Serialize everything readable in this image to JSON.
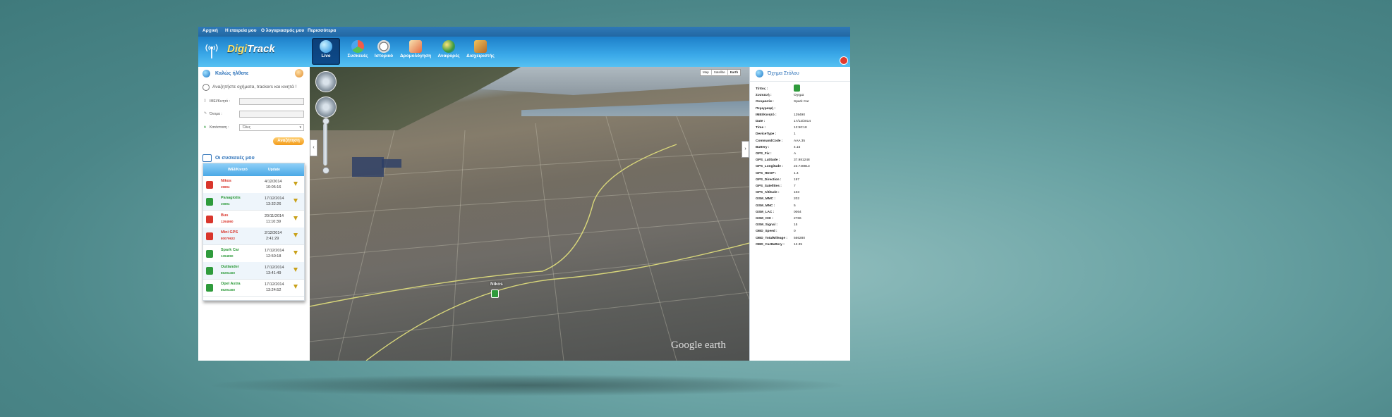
{
  "topnav": [
    "Αρχική",
    "Η εταιρεία μου",
    "Ο λογαριασμός μου",
    "Περισσότερα"
  ],
  "logo": {
    "part1": "Digi",
    "part2": "Track"
  },
  "mainnav": [
    {
      "label": "Live",
      "icon": "globe-icon",
      "active": true
    },
    {
      "label": "Συσκευές",
      "icon": "devices-icon",
      "active": false
    },
    {
      "label": "Ιστορικό",
      "icon": "clock-icon",
      "active": false
    },
    {
      "label": "Δρομολόγηση",
      "icon": "route-icon",
      "active": false
    },
    {
      "label": "Αναφορές",
      "icon": "report-icon",
      "active": false
    },
    {
      "label": "Διαχειριστής",
      "icon": "admin-icon",
      "active": false
    }
  ],
  "welcome": "Καλώς ήλθατε",
  "search": {
    "title": "Αναζητήστε οχήματα, trackers και κινητά !",
    "imei_label": "IMEI/Κινητό :",
    "name_label": "Όνομα :",
    "status_label": "Κατάσταση :",
    "status_value": "Όλες",
    "button": "Αναζήτηση"
  },
  "devices": {
    "title": "Οι συσκευές μου",
    "columns": [
      "IMEI/Κινητό",
      "Update"
    ],
    "rows": [
      {
        "name": "Nikos",
        "imei": "39894",
        "date": "4/12/2014",
        "time": "10:05:16",
        "color": "#d9362c"
      },
      {
        "name": "Panagiotis",
        "imei": "30894",
        "date": "17/12/2014",
        "time": "13:32:26",
        "color": "#2f9b3c"
      },
      {
        "name": "Bus",
        "imei": "1294860",
        "date": "20/11/2014",
        "time": "11:10:39",
        "color": "#d9362c"
      },
      {
        "name": "Mini GPS",
        "imei": "80079922",
        "date": "2/12/2014",
        "time": "2:41:29",
        "color": "#d9362c"
      },
      {
        "name": "Spark Car",
        "imei": "1394890",
        "date": "17/12/2014",
        "time": "12:50:18",
        "color": "#2f9b3c"
      },
      {
        "name": "Outlander",
        "imei": "86294460",
        "date": "17/12/2014",
        "time": "13:41:49",
        "color": "#2f9b3c"
      },
      {
        "name": "Opel Astra",
        "imei": "86294460",
        "date": "17/12/2014",
        "time": "13:24:52",
        "color": "#2f9b3c"
      }
    ]
  },
  "map": {
    "types": [
      "Map",
      "Satellite",
      "Earth"
    ],
    "marker_label": "Nikos",
    "watermark": "Google earth"
  },
  "vehicle_info": {
    "title": "Όχημα Στόλου",
    "fields": [
      {
        "k": "Τύπος :",
        "v": ""
      },
      {
        "k": "Συσκευή :",
        "v": "Όχημα"
      },
      {
        "k": "Ονομασία :",
        "v": "Spark Car"
      },
      {
        "k": "Περιγραφή :",
        "v": ""
      },
      {
        "k": "IMEI/Κινητό :",
        "v": "139490"
      },
      {
        "k": "Date :",
        "v": "17/12/2014"
      },
      {
        "k": "Time :",
        "v": "12:50:18"
      },
      {
        "k": "DeviceType :",
        "v": "1"
      },
      {
        "k": "CommandCode :",
        "v": "AAA 35"
      },
      {
        "k": "Battery :",
        "v": "4.15"
      },
      {
        "k": "GPS_Fix :",
        "v": "A"
      },
      {
        "k": "GPS_Latitude :",
        "v": "37.981248"
      },
      {
        "k": "GPS_Longitude :",
        "v": "23.748813"
      },
      {
        "k": "GPS_HDOP :",
        "v": "1.4"
      },
      {
        "k": "GPS_Direction :",
        "v": "197"
      },
      {
        "k": "GPS_Satellites :",
        "v": "7"
      },
      {
        "k": "GPS_Altitude :",
        "v": "103"
      },
      {
        "k": "GSM_MMC :",
        "v": "202"
      },
      {
        "k": "GSM_MNC :",
        "v": "5"
      },
      {
        "k": "GSM_LAC :",
        "v": "0064"
      },
      {
        "k": "GSM_CID :",
        "v": "2766"
      },
      {
        "k": "GSM_Signal :",
        "v": "15"
      },
      {
        "k": "OBD_Speed :",
        "v": "0"
      },
      {
        "k": "OBD_TotalMileage :",
        "v": "566280"
      },
      {
        "k": "OBD_CarBattery :",
        "v": "12.35"
      }
    ]
  }
}
